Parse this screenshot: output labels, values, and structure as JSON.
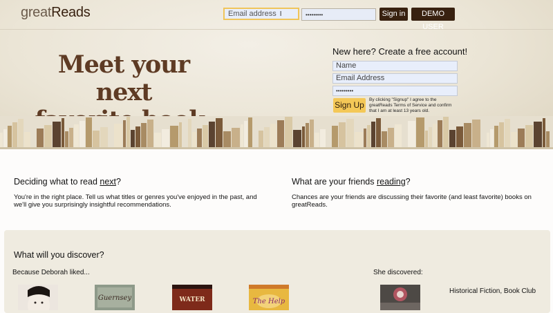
{
  "header": {
    "logo_light": "great",
    "logo_bold": "Reads",
    "email_placeholder": "Email address",
    "password_value": "•••••••••",
    "signin_label": "Sign in",
    "demo_label": "DEMO USER"
  },
  "hero": {
    "headline_line1": "Meet your next",
    "headline_line2": "favorite book."
  },
  "signup": {
    "title": "New here? Create a free account!",
    "name_placeholder": "Name",
    "email_placeholder": "Email Address",
    "password_value": "•••••••••",
    "button_label": "Sign Up",
    "terms": "By clicking \"Signup\" I agree to the greatReads Terms of Service and confirm that I am at least 13 years old."
  },
  "features": {
    "left": {
      "title_pre": "Deciding what to read ",
      "title_link": "next",
      "title_post": "?",
      "text": "You're in the right place. Tell us what titles or genres you've enjoyed in the past, and we'll give you surprisingly insightful recommendations."
    },
    "right": {
      "title_pre": "What are your friends ",
      "title_link": "reading",
      "title_post": "?",
      "text": "Chances are your friends are discussing their favorite (and least favorite) books on greatReads."
    }
  },
  "discover": {
    "title": "What will you discover?",
    "because_label": "Because Deborah liked...",
    "she_label": "She discovered:",
    "genres": "Historical Fiction, Book Club",
    "covers": [
      {
        "name": "geisha-cover",
        "color": "#e9e3dc"
      },
      {
        "name": "guernsey-cover",
        "color": "#8e9a8a",
        "title": "Guernsey"
      },
      {
        "name": "water-cover",
        "color": "#8a2d1c",
        "title": "WATER"
      },
      {
        "name": "help-cover",
        "color": "#e8b840",
        "title": "The Help"
      },
      {
        "name": "discovered-cover",
        "color": "#57524e"
      }
    ]
  },
  "colors": {
    "brand_dark": "#382110",
    "accent_yellow": "#f4c857",
    "focus_border": "#f0c55a"
  }
}
